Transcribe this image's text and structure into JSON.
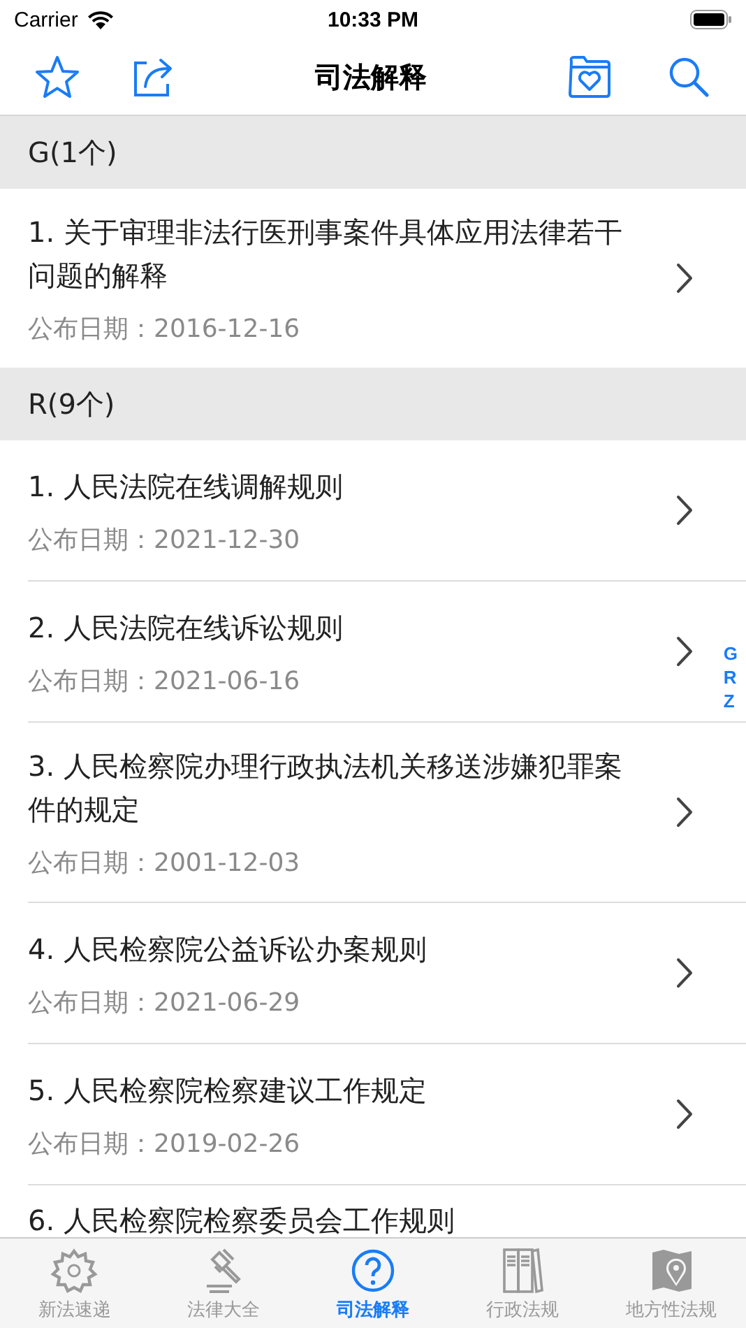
{
  "status_bar": {
    "carrier": "Carrier",
    "time": "10:33 PM"
  },
  "nav": {
    "title": "司法解释"
  },
  "sections": [
    {
      "header": "G(1个)",
      "items": [
        {
          "title": "1. 关于审理非法行医刑事案件具体应用法律若干问题的解释",
          "date": "公布日期：2016-12-16"
        }
      ]
    },
    {
      "header": "R(9个)",
      "items": [
        {
          "title": "1. 人民法院在线调解规则",
          "date": "公布日期：2021-12-30"
        },
        {
          "title": "2. 人民法院在线诉讼规则",
          "date": "公布日期：2021-06-16"
        },
        {
          "title": "3. 人民检察院办理行政执法机关移送涉嫌犯罪案件的规定",
          "date": "公布日期：2001-12-03"
        },
        {
          "title": "4. 人民检察院公益诉讼办案规则",
          "date": "公布日期：2021-06-29"
        },
        {
          "title": "5. 人民检察院检察建议工作规定",
          "date": "公布日期：2019-02-26"
        },
        {
          "title": "6. 人民检察院检察委员会工作规则"
        }
      ]
    }
  ],
  "index": [
    "G",
    "R",
    "Z"
  ],
  "tabs": [
    {
      "label": "新法速递",
      "kind": "new",
      "selected": false
    },
    {
      "label": "法律大全",
      "kind": "gavel",
      "selected": false
    },
    {
      "label": "司法解释",
      "kind": "question",
      "selected": true
    },
    {
      "label": "行政法规",
      "kind": "books",
      "selected": false
    },
    {
      "label": "地方性法规",
      "kind": "map",
      "selected": false
    }
  ]
}
